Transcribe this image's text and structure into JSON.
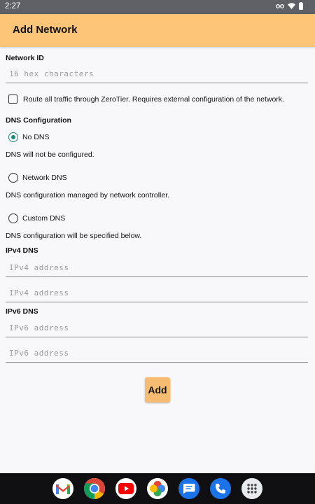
{
  "status_bar": {
    "time": "2:27"
  },
  "app_bar": {
    "title": "Add Network"
  },
  "network_id": {
    "label": "Network ID",
    "placeholder": "16 hex characters",
    "value": ""
  },
  "route_all": {
    "label": "Route all traffic through ZeroTier. Requires external configuration of the network.",
    "checked": false
  },
  "dns": {
    "heading": "DNS Configuration",
    "options": [
      {
        "label": "No DNS",
        "description": "DNS will not be configured.",
        "selected": true
      },
      {
        "label": "Network DNS",
        "description": "DNS configuration managed by network controller.",
        "selected": false
      },
      {
        "label": "Custom DNS",
        "description": "DNS configuration will be specified below.",
        "selected": false
      }
    ]
  },
  "ipv4": {
    "label": "IPv4 DNS",
    "placeholder_1": "IPv4 address",
    "placeholder_2": "IPv4 address"
  },
  "ipv6": {
    "label": "IPv6 DNS",
    "placeholder_1": "IPv6 address",
    "placeholder_2": "IPv6 address"
  },
  "actions": {
    "add_label": "Add"
  },
  "dock": {
    "apps": [
      "gmail-icon",
      "chrome-icon",
      "youtube-icon",
      "photos-icon",
      "messages-icon",
      "phone-icon",
      "app-drawer-icon"
    ]
  },
  "colors": {
    "accent": "#fcc477",
    "radio_selected": "#1f8a78",
    "add_button": "#f6bd72"
  }
}
